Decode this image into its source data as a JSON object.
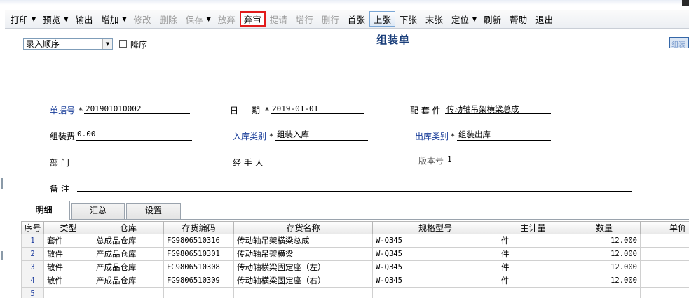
{
  "toolbar": {
    "print": "打印",
    "preview": "预览",
    "output": "输出",
    "add": "增加",
    "modify": "修改",
    "delete": "删除",
    "save": "保存",
    "abandon": "放弃",
    "unaudit": "弃审",
    "submit": "提请",
    "add_row": "增行",
    "delete_row": "删行",
    "first": "首张",
    "prev": "上张",
    "next": "下张",
    "last": "末张",
    "locate": "定位",
    "refresh": "刷新",
    "help": "帮助",
    "exit": "退出"
  },
  "sort": {
    "selected": "录入顺序",
    "desc_label": "降序"
  },
  "title": "组装单",
  "right_button": "组装",
  "fields": {
    "doc_no_label": "单据号",
    "doc_no": "201901010002",
    "date_label_1": "日",
    "date_label_2": "期",
    "date": "2019-01-01",
    "kit_label": "配 套 件",
    "kit": "传动轴吊架横梁总成",
    "fee_label": "组装费",
    "fee": "0.00",
    "in_type_label": "入库类别",
    "in_type": "组装入库",
    "out_type_label": "出库类别",
    "out_type": "组装出库",
    "dept_label": "部    门",
    "dept": "",
    "handler_label": "经 手 人",
    "handler": "",
    "version_label": "版本号",
    "version": "1",
    "remark_label": "备    注",
    "remark": "",
    "required_mark": "*"
  },
  "tabs": [
    "明细",
    "汇总",
    "设置"
  ],
  "grid": {
    "columns": [
      "序号",
      "类型",
      "仓库",
      "存货编码",
      "存货名称",
      "规格型号",
      "主计量",
      "数量",
      "单价"
    ],
    "rows": [
      {
        "no": "1",
        "type": "套件",
        "warehouse": "总成品仓库",
        "code": "FG9806510316",
        "name": "传动轴吊架横梁总成",
        "spec": "W-Q345",
        "unit": "件",
        "qty": "12.000",
        "price": ""
      },
      {
        "no": "2",
        "type": "散件",
        "warehouse": "产成品仓库",
        "code": "FG9806510301",
        "name": "传动轴吊架横梁",
        "spec": "W-Q345",
        "unit": "件",
        "qty": "12.000",
        "price": ""
      },
      {
        "no": "3",
        "type": "散件",
        "warehouse": "产成品仓库",
        "code": "FG9806510308",
        "name": "传动轴横梁固定座（左）",
        "spec": "W-Q345",
        "unit": "件",
        "qty": "12.000",
        "price": ""
      },
      {
        "no": "4",
        "type": "散件",
        "warehouse": "产成品仓库",
        "code": "FG9806510309",
        "name": "传动轴横梁固定座（右）",
        "spec": "W-Q345",
        "unit": "件",
        "qty": "12.000",
        "price": ""
      },
      {
        "no": "5",
        "type": "",
        "warehouse": "",
        "code": "",
        "name": "",
        "spec": "",
        "unit": "",
        "qty": "",
        "price": ""
      }
    ]
  }
}
